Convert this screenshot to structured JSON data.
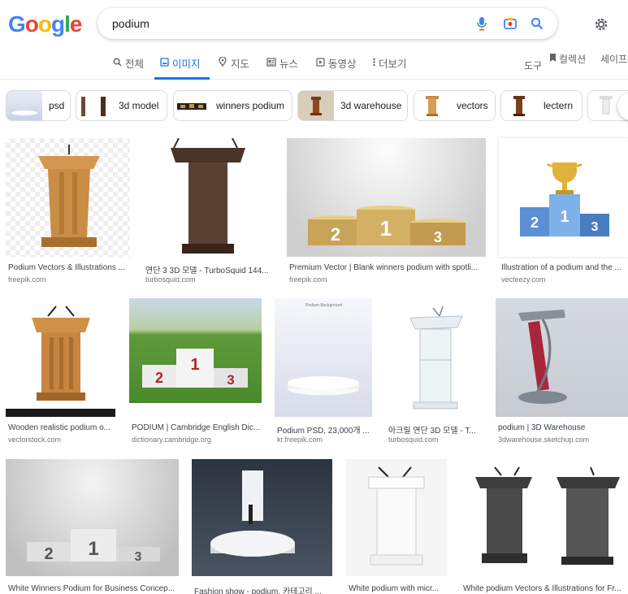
{
  "logo": {
    "letters": [
      "G",
      "o",
      "o",
      "g",
      "l",
      "e"
    ],
    "colors": [
      "#4285f4",
      "#ea4335",
      "#fbbc05",
      "#4285f4",
      "#34a853",
      "#ea4335"
    ]
  },
  "search": {
    "query": "podium",
    "icons": [
      "mic-icon",
      "camera-lens-icon",
      "search-icon"
    ]
  },
  "settings_icon": "gear-icon",
  "tabs": [
    {
      "label": "전체",
      "icon": "search-icon"
    },
    {
      "label": "이미지",
      "icon": "image-icon",
      "active": true
    },
    {
      "label": "지도",
      "icon": "map-pin-icon"
    },
    {
      "label": "뉴스",
      "icon": "news-icon"
    },
    {
      "label": "동영상",
      "icon": "play-icon"
    },
    {
      "label": "더보기",
      "icon": "more-vert-icon"
    }
  ],
  "tools": {
    "tools_label": "도구",
    "collections_label": "컬렉션",
    "safesearch_label": "세이프서"
  },
  "chips": [
    {
      "label": "psd"
    },
    {
      "label": "3d model"
    },
    {
      "label": "winners podium"
    },
    {
      "label": "3d warehouse"
    },
    {
      "label": "vectors"
    },
    {
      "label": "lectern"
    }
  ],
  "results": [
    {
      "title": "Podium Vectors & Illustrations ...",
      "source": "freepik.com"
    },
    {
      "title": "연단 3 3D 모델 - TurboSquid 144...",
      "source": "turbosquid.com"
    },
    {
      "title": "Premium Vector | Blank winners podium with spotli...",
      "source": "freepik.com"
    },
    {
      "title": "Illustration of a podium and the ...",
      "source": "vecteezy.com"
    },
    {
      "title": "Wooden realistic podium o...",
      "source": "vectorstock.com"
    },
    {
      "title": "PODIUM | Cambridge English Dic...",
      "source": "dictionary.cambridge.org"
    },
    {
      "title": "Podium PSD, 23,000개 ...",
      "source": "kr.freepik.com"
    },
    {
      "title": "아크릴 연단 3D 모델 - T...",
      "source": "turbosquid.com"
    },
    {
      "title": "podium | 3D Warehouse",
      "source": "3dwarehouse.sketchup.com"
    },
    {
      "title": "White Winners Podium for Business Concep...",
      "source": ""
    },
    {
      "title": "Fashion show - podium, 카테고리 ...",
      "source": ""
    },
    {
      "title": "White podium with micr...",
      "source": ""
    },
    {
      "title": "White podium Vectors & Illustrations for Fr...",
      "source": ""
    }
  ],
  "podium_numbers": {
    "first": "1",
    "second": "2",
    "third": "3"
  },
  "watermarks": {
    "psd_header": "Podium Background"
  },
  "colors": {
    "accent": "#1a73e8",
    "wood": "#c98d45",
    "gold": "#e2b13c",
    "blue_podium": "#5b8fd6",
    "red_podium": "#b02233"
  }
}
